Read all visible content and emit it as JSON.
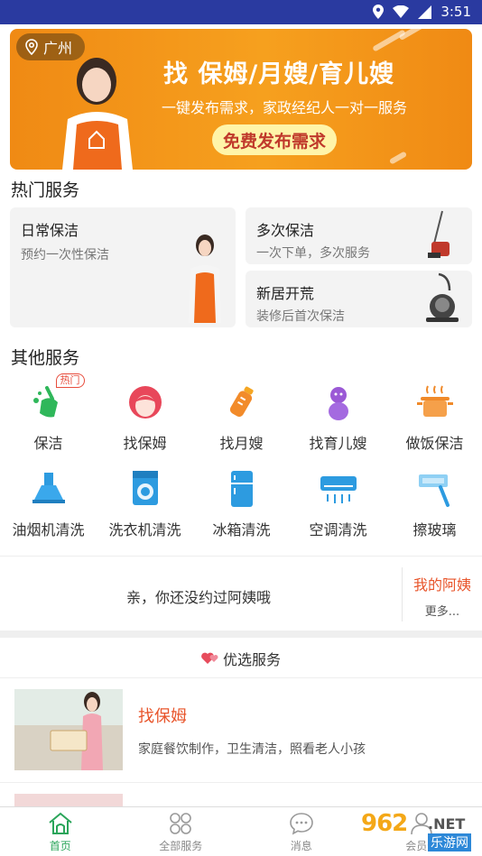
{
  "status_bar": {
    "time": "3:51"
  },
  "banner": {
    "location": "广州",
    "title": "找 保姆/月嫂/育儿嫂",
    "subtitle": "一键发布需求，家政经纪人一对一服务",
    "cta": "免费发布需求"
  },
  "hot_services": {
    "title": "热门服务",
    "cards": [
      {
        "title": "日常保洁",
        "subtitle": "预约一次性保洁"
      },
      {
        "title": "多次保洁",
        "subtitle": "一次下单，多次服务"
      },
      {
        "title": "新居开荒",
        "subtitle": "装修后首次保洁"
      }
    ]
  },
  "other_services": {
    "title": "其他服务",
    "hot_badge": "热门",
    "items": [
      {
        "label": "保洁",
        "icon": "broom-icon"
      },
      {
        "label": "找保姆",
        "icon": "nanny-icon"
      },
      {
        "label": "找月嫂",
        "icon": "baby-bottle-icon"
      },
      {
        "label": "找育儿嫂",
        "icon": "baby-icon"
      },
      {
        "label": "做饭保洁",
        "icon": "cooking-pot-icon"
      },
      {
        "label": "油烟机清洗",
        "icon": "range-hood-icon"
      },
      {
        "label": "洗衣机清洗",
        "icon": "washing-machine-icon"
      },
      {
        "label": "冰箱清洗",
        "icon": "fridge-icon"
      },
      {
        "label": "空调清洗",
        "icon": "air-conditioner-icon"
      },
      {
        "label": "擦玻璃",
        "icon": "window-wiper-icon"
      }
    ]
  },
  "ayi": {
    "empty_text": "亲，你还没约过阿姨哦",
    "side_title": "我的阿姨",
    "side_more": "更多..."
  },
  "preferred": {
    "title": "优选服务",
    "items": [
      {
        "title": "找保姆",
        "desc": "家庭餐饮制作，卫生清洁，照看老人小孩"
      }
    ]
  },
  "bottom_nav": [
    {
      "label": "首页",
      "icon": "home-icon",
      "active": true
    },
    {
      "label": "全部服务",
      "icon": "grid-icon",
      "active": false
    },
    {
      "label": "消息",
      "icon": "message-icon",
      "active": false
    },
    {
      "label": "会员卡",
      "icon": "member-icon",
      "active": false
    }
  ],
  "watermark": {
    "number": "962",
    "suffix": ".NET",
    "cn": "乐游网"
  },
  "colors": {
    "accent": "#e8552b",
    "status_bar": "#2a3aa0",
    "banner": "#f6a01e",
    "nav_active": "#2aa55a"
  }
}
